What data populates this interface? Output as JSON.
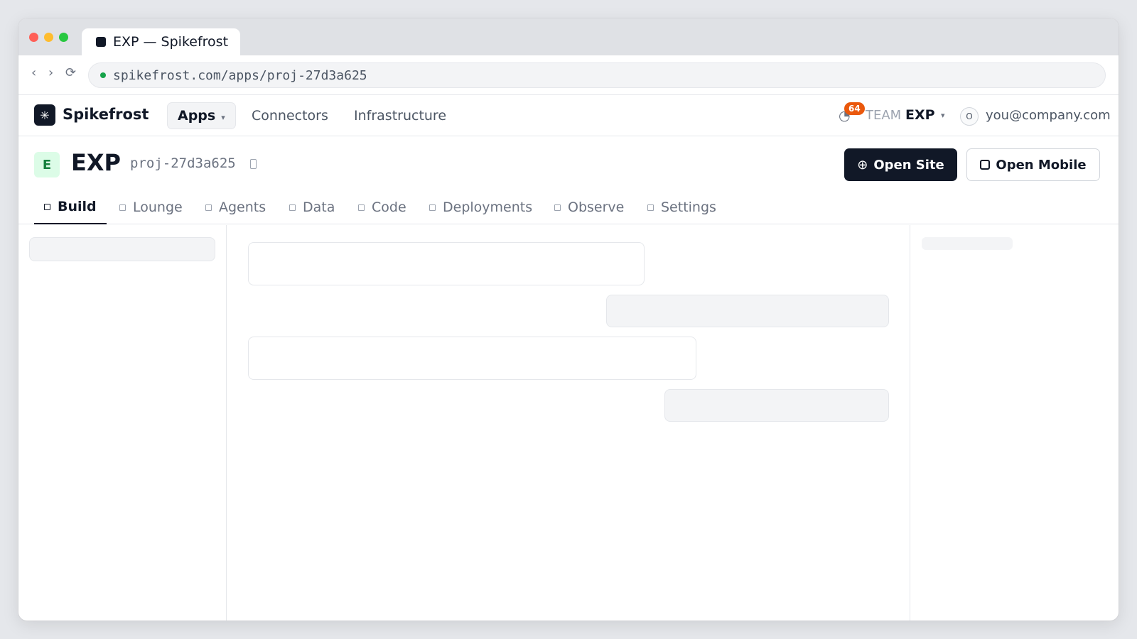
{
  "browser": {
    "tab_title": "EXP — Spikefrost",
    "url": "spikefrost.com/apps/proj-27d3a625",
    "back_glyph": "‹",
    "forward_glyph": "›",
    "reload_glyph": "⟳"
  },
  "header": {
    "logo_glyph": "✳",
    "brand": "Spikefrost",
    "nav": [
      {
        "label": "Apps",
        "caret": "▾"
      },
      {
        "label": "Connectors"
      },
      {
        "label": "Infrastructure"
      }
    ],
    "clock_glyph": "◔",
    "notification_count": "64",
    "team_label": "TEAM",
    "team_name": "EXP",
    "team_caret": "▾",
    "avatar_initial": "O",
    "email": "you@company.com"
  },
  "project": {
    "badge": "E",
    "title": "EXP",
    "id": "proj-27d3a625",
    "open_site_icon": "⊕",
    "open_site": "Open Site",
    "open_mobile": "Open Mobile"
  },
  "tabs": [
    {
      "label": "Build"
    },
    {
      "label": "Lounge"
    },
    {
      "label": "Agents"
    },
    {
      "label": "Data"
    },
    {
      "label": "Code"
    },
    {
      "label": "Deployments"
    },
    {
      "label": "Observe"
    },
    {
      "label": "Settings"
    }
  ],
  "colors": {
    "accent": "#111827",
    "notification": "#ea580c",
    "project_badge_bg": "#dcfce7",
    "project_badge_fg": "#15803d",
    "secure": "#16a34a"
  },
  "icons": {
    "clock": "clock-icon",
    "copy": "copy-icon",
    "open_site": "globe-icon",
    "open_mobile": "mobile-icon",
    "tab": "square-icon"
  }
}
